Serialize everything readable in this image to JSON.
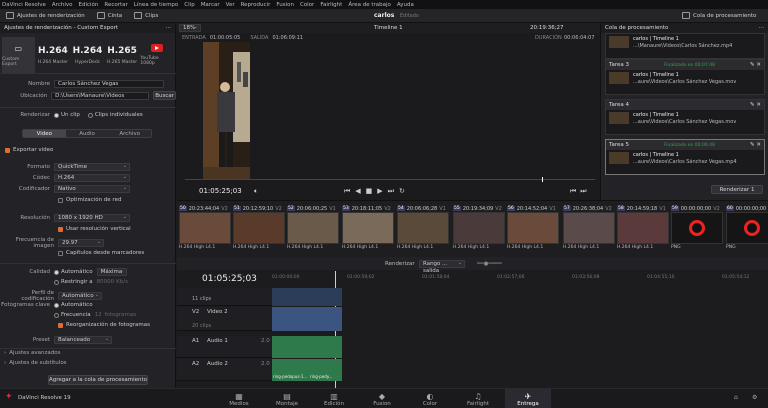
{
  "menu": [
    "DaVinci Resolve",
    "Archivo",
    "Edición",
    "Recortar",
    "Línea de tiempo",
    "Clip",
    "Marcar",
    "Ver",
    "Reproducir",
    "Fusion",
    "Color",
    "Fairlight",
    "Área de trabajo",
    "Ayuda"
  ],
  "toolbar": {
    "render_settings": "Ajustes de renderización",
    "cinta": "Cinta",
    "clips": "Clips",
    "project_title": "carlos",
    "edited": "Editado",
    "render_queue": "Cola de procesamiento"
  },
  "left": {
    "header": "Ajustes de renderización - Custom Export",
    "presets": [
      {
        "big": "",
        "label": "Custom Export"
      },
      {
        "big": "H.264",
        "label": "H.264 Master"
      },
      {
        "big": "H.264",
        "label": "HyperDeck"
      },
      {
        "big": "H.265",
        "label": "H.265 Master"
      },
      {
        "big": "",
        "label": "YouTube 1080p"
      }
    ],
    "nombre_label": "Nombre",
    "nombre_value": "Carlos Sánchez Vegas",
    "ubicacion_label": "Ubicación",
    "ubicacion_value": "D:\\Users\\Manaure\\Videos",
    "buscar": "Buscar",
    "renderizar_label": "Renderizar",
    "un_clip": "Un clip",
    "clips_individuales": "Clips individuales",
    "tabs": [
      "Video",
      "Audio",
      "Archivo"
    ],
    "exportar_video": "Exportar video",
    "formato_label": "Formato",
    "formato_value": "QuickTime",
    "codec_label": "Códec",
    "codec_value": "H.264",
    "codificador_label": "Codificador",
    "codificador_value": "Nativo",
    "optimizacion": "Optimización de red",
    "resolucion_label": "Resolución",
    "resolucion_value": "1080 x 1920 HD",
    "usar_vertical": "Usar resolución vertical",
    "frecuencia_label": "Frecuencia de imagen",
    "frecuencia_value": "29.97",
    "capitulos": "Capítulos desde marcadores",
    "calidad_label": "Calidad",
    "automatico": "Automático",
    "maxima": "Máxima",
    "restringir": "Restringir a",
    "kbs": "80000",
    "kbs_unit": "Kb/s",
    "perfil_label": "Perfil de codificación",
    "perfil_value": "Automático",
    "fotogramas_label": "Fotogramas clave",
    "fotogramas_auto": "Automático",
    "frecuencia": "Frecuencia",
    "frec_val": "12",
    "fotogramas_word": "fotogramas",
    "reorganizacion": "Reorganización de fotogramas",
    "preset_label": "Preset",
    "preset_value": "Balanceado",
    "ajustes_avanzados": "Ajustes avanzados",
    "ajustes_subtitulos": "Ajustes de subtítulos",
    "agregar": "Agregar a la cola de procesamiento"
  },
  "viewer": {
    "zoom": "18%",
    "timeline": "Timeline 1",
    "timecode_top": "20:19:36;27",
    "entrada_label": "ENTRADA",
    "entrada": "01:00:05:05",
    "salida_label": "SALIDA",
    "salida": "01:06:09:11",
    "duracion_label": "DURACIÓN",
    "duracion": "00:06:04:07",
    "timecode": "01:05:25;03"
  },
  "queue": {
    "jobs": [
      {
        "title": "",
        "name": "carlos | Timeline 1",
        "path": "...\\Manaure\\Videos\\Carlos Sánchez.mp4",
        "status": ""
      },
      {
        "title": "Tarea 3",
        "name": "carlos | Timeline 1",
        "path": "...aure\\Videos\\Carlos Sánchez Vegas.mov",
        "status": "Finalizado en 00:07:48"
      },
      {
        "title": "Tarea 4",
        "name": "carlos | Timeline 1",
        "path": "...aure\\Videos\\Carlos Sánchez Vegas.mov",
        "status": ""
      },
      {
        "title": "Tarea 5",
        "name": "carlos | Timeline 1",
        "path": "...aure\\Videos\\Carlos Sánchez Vegas.mp4",
        "status": "Finalizado en 00:06:48"
      }
    ],
    "render_all": "Renderizar 1"
  },
  "clips": [
    {
      "n": "50",
      "tc": "20:23:44;04",
      "tr": "V2",
      "cap": "H.264 High L4.1"
    },
    {
      "n": "51",
      "tc": "20:12:59;10",
      "tr": "V2",
      "cap": "H.264 High L4.1"
    },
    {
      "n": "52",
      "tc": "20:06:00;25",
      "tr": "V1",
      "cap": "H.264 High L4.1"
    },
    {
      "n": "53",
      "tc": "20:18:11;05",
      "tr": "V2",
      "cap": "H.264 High L4.1"
    },
    {
      "n": "54",
      "tc": "20:06:06;28",
      "tr": "V1",
      "cap": "H.264 High L4.1"
    },
    {
      "n": "55",
      "tc": "20:19:34;09",
      "tr": "V2",
      "cap": "H.264 High L4.1"
    },
    {
      "n": "56",
      "tc": "20:14:52;04",
      "tr": "V1",
      "cap": "H.264 High L4.1"
    },
    {
      "n": "57",
      "tc": "20:26:38;04",
      "tr": "V2",
      "cap": "H.264 High L4.1"
    },
    {
      "n": "58",
      "tc": "20:14:59;18",
      "tr": "V1",
      "cap": "H.264 High L4.1"
    },
    {
      "n": "59",
      "tc": "00:00:00;00",
      "tr": "V2",
      "cap": "PNG"
    },
    {
      "n": "60",
      "tc": "00:00:00;00",
      "tr": "V2",
      "cap": "PNG"
    }
  ],
  "timeline": {
    "renderizar": "Renderizar",
    "rango": "Rango ... salida",
    "timecode": "01:05:25;03",
    "ruler": [
      "01:00:00;00",
      "01:00:59;02",
      "01:01:58;04",
      "01:02:57;06",
      "01:03:56;08",
      "01:04:55;10",
      "01:05:54;12"
    ],
    "tracks": [
      {
        "id": "",
        "name": "11 clips"
      },
      {
        "id": "V2",
        "name": "Video 2"
      },
      {
        "id": "",
        "name": "20 clips"
      },
      {
        "id": "A1",
        "name": "Audio 1",
        "ch": "2.0"
      },
      {
        "id": "A2",
        "name": "Audio 2",
        "ch": "2.0"
      }
    ],
    "audio_clip1": "ring-pedopus-1...",
    "audio_clip2": "ring-pedy..."
  },
  "pages": [
    "Medios",
    "Montaje",
    "Edición",
    "Fusion",
    "Color",
    "Fairlight",
    "Entrega"
  ],
  "brand": "DaVinci Resolve 19"
}
